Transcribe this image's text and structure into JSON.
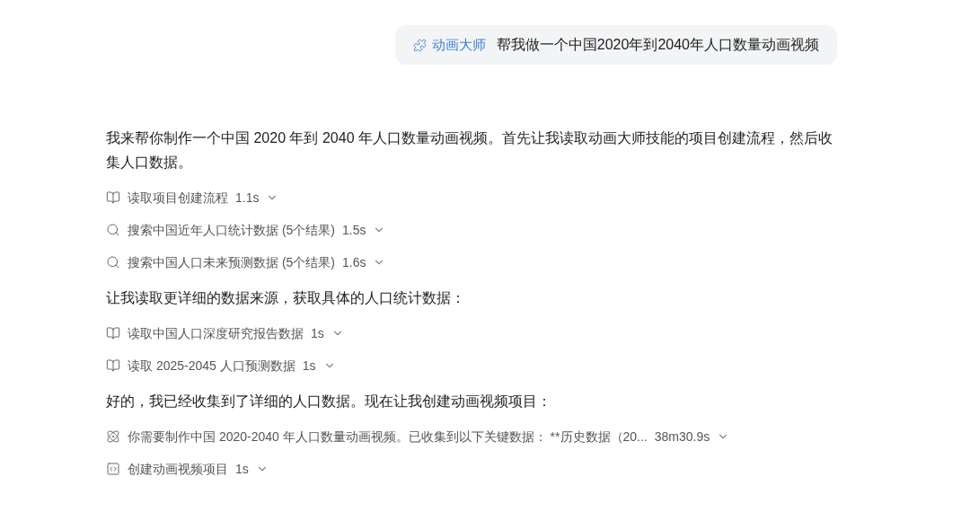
{
  "user_message": {
    "skill": "动画大师",
    "text": "帮我做一个中国2020年到2040年人口数量动画视频"
  },
  "blocks": [
    {
      "kind": "paragraph",
      "text": "我来帮你制作一个中国 2020 年到 2040 年人口数量动画视频。首先让我读取动画大师技能的项目创建流程，然后收集人口数据。"
    },
    {
      "kind": "read",
      "label": "读取项目创建流程",
      "duration": "1.1s"
    },
    {
      "kind": "search",
      "label": "搜索中国近年人口统计数据 (5个结果)",
      "duration": "1.5s"
    },
    {
      "kind": "search",
      "label": "搜索中国人口未来预测数据 (5个结果)",
      "duration": "1.6s"
    },
    {
      "kind": "paragraph",
      "text": "让我读取更详细的数据来源，获取具体的人口统计数据："
    },
    {
      "kind": "read",
      "label": "读取中国人口深度研究报告数据",
      "duration": "1s"
    },
    {
      "kind": "read",
      "label": "读取 2025-2045 人口预测数据",
      "duration": "1s"
    },
    {
      "kind": "paragraph",
      "text": "好的，我已经收集到了详细的人口数据。现在让我创建动画视频项目："
    },
    {
      "kind": "agent",
      "label": "你需要制作中国 2020-2040 年人口数量动画视频。已收集到以下关键数据： **历史数据（20...",
      "duration": "38m30.9s"
    },
    {
      "kind": "code",
      "label": "创建动画视频项目",
      "duration": "1s"
    }
  ]
}
